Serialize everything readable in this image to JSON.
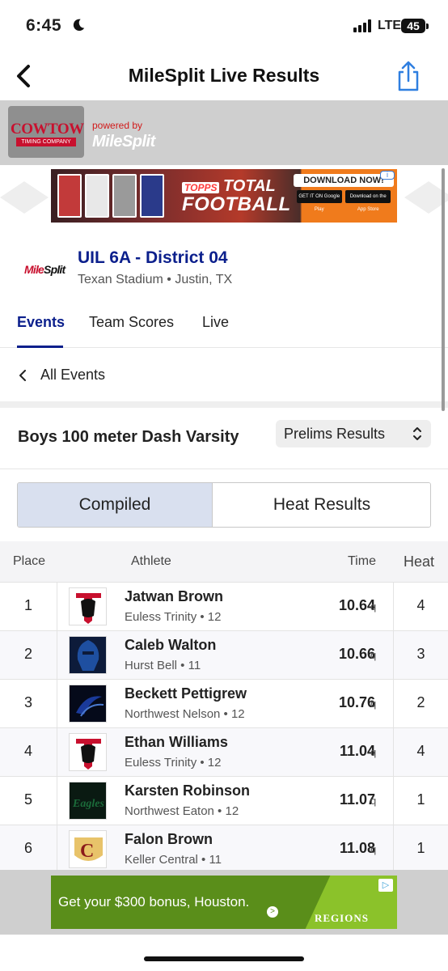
{
  "status": {
    "time": "6:45",
    "network": "LTE",
    "battery": "45"
  },
  "nav": {
    "title": "MileSplit Live Results",
    "back_icon": "chevron-left-icon",
    "share_icon": "share-icon"
  },
  "brand": {
    "timer_name": "COWTOWN",
    "timer_sub": "TIMING COMPANY",
    "powered_by": "powered by",
    "milesplit": "MileSplit"
  },
  "top_ad": {
    "brand": "TOPPS",
    "line1": "TOTAL",
    "line2": "FOOTBALL",
    "cta": "DOWNLOAD NOW!",
    "store1": "GET IT ON Google Play",
    "store2": "Download on the App Store",
    "info": "i",
    "bg_color": "#f07b1c"
  },
  "meet": {
    "logo_a": "Mile",
    "logo_b": "Split",
    "title": "UIL 6A - District 04",
    "venue": "Texan Stadium • Justin, TX"
  },
  "tabs": [
    {
      "label": "Events",
      "active": true
    },
    {
      "label": "Team Scores",
      "active": false
    },
    {
      "label": "Live",
      "active": false
    }
  ],
  "all_events": {
    "label": "All Events"
  },
  "event": {
    "name": "Boys 100 meter Dash Varsity",
    "round": "Prelims Results"
  },
  "segments": {
    "compiled": "Compiled",
    "heat": "Heat Results"
  },
  "table": {
    "headers": {
      "place": "Place",
      "athlete": "Athlete",
      "time": "Time",
      "heat": "Heat"
    },
    "rows": [
      {
        "place": "1",
        "name": "Jatwan Brown",
        "meta": "Euless Trinity • 12",
        "time": "10.64",
        "q": "q",
        "heat": "4",
        "logo": "trojan-helmet-icon",
        "logo_color": "#c8102e"
      },
      {
        "place": "2",
        "name": "Caleb Walton",
        "meta": "Hurst Bell • 11",
        "time": "10.66",
        "q": "q",
        "heat": "3",
        "logo": "knight-helmet-icon",
        "logo_color": "#1e4fa0"
      },
      {
        "place": "3",
        "name": "Beckett Pettigrew",
        "meta": "Northwest Nelson • 12",
        "time": "10.76",
        "q": "q",
        "heat": "2",
        "logo": "nelson-logo-icon",
        "logo_color": "#1a3a9a"
      },
      {
        "place": "4",
        "name": "Ethan Williams",
        "meta": "Euless Trinity • 12",
        "time": "11.04",
        "q": "q",
        "heat": "4",
        "logo": "trojan-helmet-icon",
        "logo_color": "#c8102e"
      },
      {
        "place": "5",
        "name": "Karsten Robinson",
        "meta": "Northwest Eaton • 12",
        "time": "11.07",
        "q": "q",
        "heat": "1",
        "logo": "eagles-script-icon",
        "logo_color": "#1b6b3a"
      },
      {
        "place": "6",
        "name": "Falon Brown",
        "meta": "Keller Central • 11",
        "time": "11.08",
        "q": "q",
        "heat": "1",
        "logo": "keller-c-icon",
        "logo_color": "#8b1a1a"
      }
    ]
  },
  "bottom_ad": {
    "text": "Get your $300 bonus, Houston.",
    "brand": "REGIONS",
    "info": "▷"
  }
}
